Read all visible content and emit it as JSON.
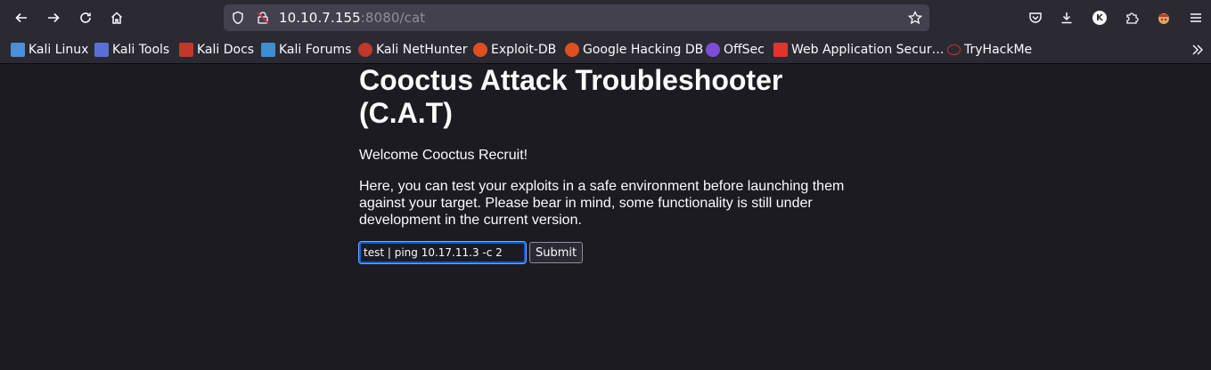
{
  "browser": {
    "url_host": "10.10.7.155",
    "url_rest": ":8080/cat",
    "bookmarks": [
      {
        "label": "Kali Linux",
        "color": "#4a90d9"
      },
      {
        "label": "Kali Tools",
        "color": "#5a6fd6"
      },
      {
        "label": "Kali Docs",
        "color": "#c0392b"
      },
      {
        "label": "Kali Forums",
        "color": "#3d8fd1"
      },
      {
        "label": "Kali NetHunter",
        "color": "#c0392b"
      },
      {
        "label": "Exploit-DB",
        "color": "#e0501f"
      },
      {
        "label": "Google Hacking DB",
        "color": "#e0501f"
      },
      {
        "label": "OffSec",
        "color": "#7d4cdb"
      },
      {
        "label": "Web Application Secur…",
        "color": "#e5322d"
      },
      {
        "label": "TryHackMe",
        "color": "#c0392b"
      }
    ],
    "profile_initial": "K"
  },
  "page": {
    "title": "Cooctus Attack Troubleshooter (C.A.T)",
    "welcome": "Welcome Cooctus Recruit!",
    "description": "Here, you can test your exploits in a safe environment before launching them against your target. Please bear in mind, some functionality is still under development in the current version.",
    "command_value": "test | ping 10.17.11.3 -c 2",
    "submit_label": "Submit"
  }
}
